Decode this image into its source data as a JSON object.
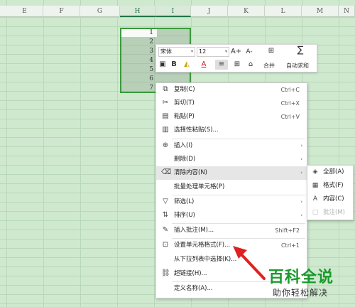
{
  "columns": [
    "E",
    "F",
    "G",
    "H",
    "I",
    "J",
    "K",
    "L",
    "M",
    "N"
  ],
  "active_columns": [
    "H",
    "I"
  ],
  "rows": [
    "1",
    "2",
    "3",
    "4",
    "5",
    "6",
    "7"
  ],
  "minibar": {
    "font": "宋体",
    "size": "12",
    "grow_font": "A+",
    "shrink_font": "A-",
    "bold": "B",
    "merge_label": "合并",
    "autosum_label": "自动求和"
  },
  "menu": {
    "copy": {
      "label": "复制(C)",
      "shortcut": "Ctrl+C"
    },
    "cut": {
      "label": "剪切(T)",
      "shortcut": "Ctrl+X"
    },
    "paste": {
      "label": "粘贴(P)",
      "shortcut": "Ctrl+V"
    },
    "paste_special": {
      "label": "选择性粘贴(S)..."
    },
    "insert": {
      "label": "插入(I)"
    },
    "delete": {
      "label": "删除(D)"
    },
    "clear": {
      "label": "清除内容(N)"
    },
    "batch": {
      "label": "批量处理单元格(P)"
    },
    "filter": {
      "label": "筛选(L)"
    },
    "sort": {
      "label": "排序(U)"
    },
    "comment": {
      "label": "插入批注(M)...",
      "shortcut": "Shift+F2"
    },
    "format_cells": {
      "label": "设置单元格格式(F)...",
      "shortcut": "Ctrl+1"
    },
    "dropdown_pick": {
      "label": "从下拉列表中选择(K)..."
    },
    "hyperlink": {
      "label": "超链接(H)..."
    },
    "define_name": {
      "label": "定义名称(A)..."
    }
  },
  "submenu": {
    "all": "全部(A)",
    "format": "格式(F)",
    "content": "内容(C)",
    "comment": "批注(M)"
  },
  "watermark": {
    "title": "百科全说",
    "subtitle": "助你轻松解决"
  },
  "colors": {
    "sheet_bg": "#cfe9cf",
    "selection_border": "#3a9a3a",
    "watermark_green": "#1a9a2c",
    "arrow_red": "#e02020"
  }
}
